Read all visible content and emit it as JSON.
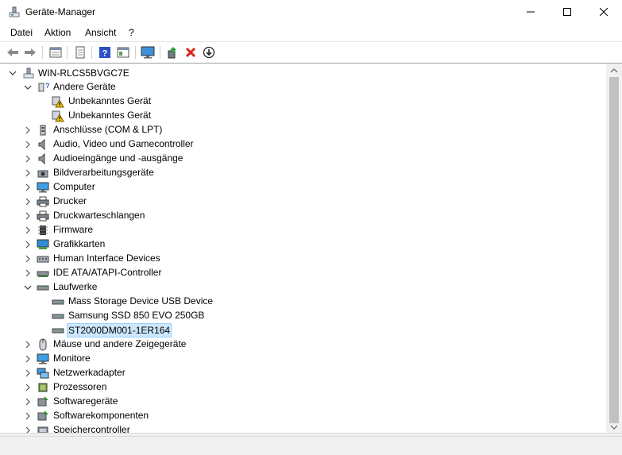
{
  "window": {
    "title": "Geräte-Manager"
  },
  "menu": {
    "items": [
      "Datei",
      "Aktion",
      "Ansicht",
      "?"
    ]
  },
  "toolbar": {
    "buttons": [
      "back-icon",
      "forward-icon",
      "properties-grid-icon",
      "page-icon",
      "help-icon",
      "view-icon",
      "monitor-scan-icon",
      "driver-update-icon",
      "uninstall-icon",
      "download-icon"
    ]
  },
  "tree": {
    "root": "WIN-RLCS5BVGC7E",
    "items": [
      {
        "label": "Andere Geräte",
        "level": 1,
        "expanded": true,
        "icon": "unknown-device-icon"
      },
      {
        "label": "Unbekanntes Gerät",
        "level": 2,
        "icon": "warning-device-icon"
      },
      {
        "label": "Unbekanntes Gerät",
        "level": 2,
        "icon": "warning-device-icon"
      },
      {
        "label": "Anschlüsse (COM & LPT)",
        "level": 1,
        "icon": "port-icon"
      },
      {
        "label": "Audio, Video und Gamecontroller",
        "level": 1,
        "icon": "speaker-icon"
      },
      {
        "label": "Audioeingänge und -ausgänge",
        "level": 1,
        "icon": "speaker-icon"
      },
      {
        "label": "Bildverarbeitungsgeräte",
        "level": 1,
        "icon": "camera-icon"
      },
      {
        "label": "Computer",
        "level": 1,
        "icon": "computer-icon"
      },
      {
        "label": "Drucker",
        "level": 1,
        "icon": "printer-icon"
      },
      {
        "label": "Druckwarteschlangen",
        "level": 1,
        "icon": "printer-icon"
      },
      {
        "label": "Firmware",
        "level": 1,
        "icon": "chip-icon"
      },
      {
        "label": "Grafikkarten",
        "level": 1,
        "icon": "display-adapter-icon"
      },
      {
        "label": "Human Interface Devices",
        "level": 1,
        "icon": "hid-icon"
      },
      {
        "label": "IDE ATA/ATAPI-Controller",
        "level": 1,
        "icon": "ide-icon"
      },
      {
        "label": "Laufwerke",
        "level": 1,
        "expanded": true,
        "icon": "drive-icon"
      },
      {
        "label": "Mass Storage Device USB Device",
        "level": 2,
        "icon": "drive-icon"
      },
      {
        "label": "Samsung SSD 850 EVO 250GB",
        "level": 2,
        "icon": "drive-icon"
      },
      {
        "label": "ST2000DM001-1ER164",
        "level": 2,
        "icon": "drive-icon",
        "selected": true
      },
      {
        "label": "Mäuse und andere Zeigegeräte",
        "level": 1,
        "icon": "mouse-icon"
      },
      {
        "label": "Monitore",
        "level": 1,
        "icon": "monitor-icon"
      },
      {
        "label": "Netzwerkadapter",
        "level": 1,
        "icon": "network-icon"
      },
      {
        "label": "Prozessoren",
        "level": 1,
        "icon": "processor-icon"
      },
      {
        "label": "Softwaregeräte",
        "level": 1,
        "icon": "software-device-icon"
      },
      {
        "label": "Softwarekomponenten",
        "level": 1,
        "icon": "software-component-icon"
      },
      {
        "label": "Speichercontroller",
        "level": 1,
        "icon": "storage-controller-icon"
      }
    ]
  },
  "colors": {
    "selection": "#cce8ff",
    "selection_border": "#99d1ff",
    "accent": "#0078d7"
  }
}
